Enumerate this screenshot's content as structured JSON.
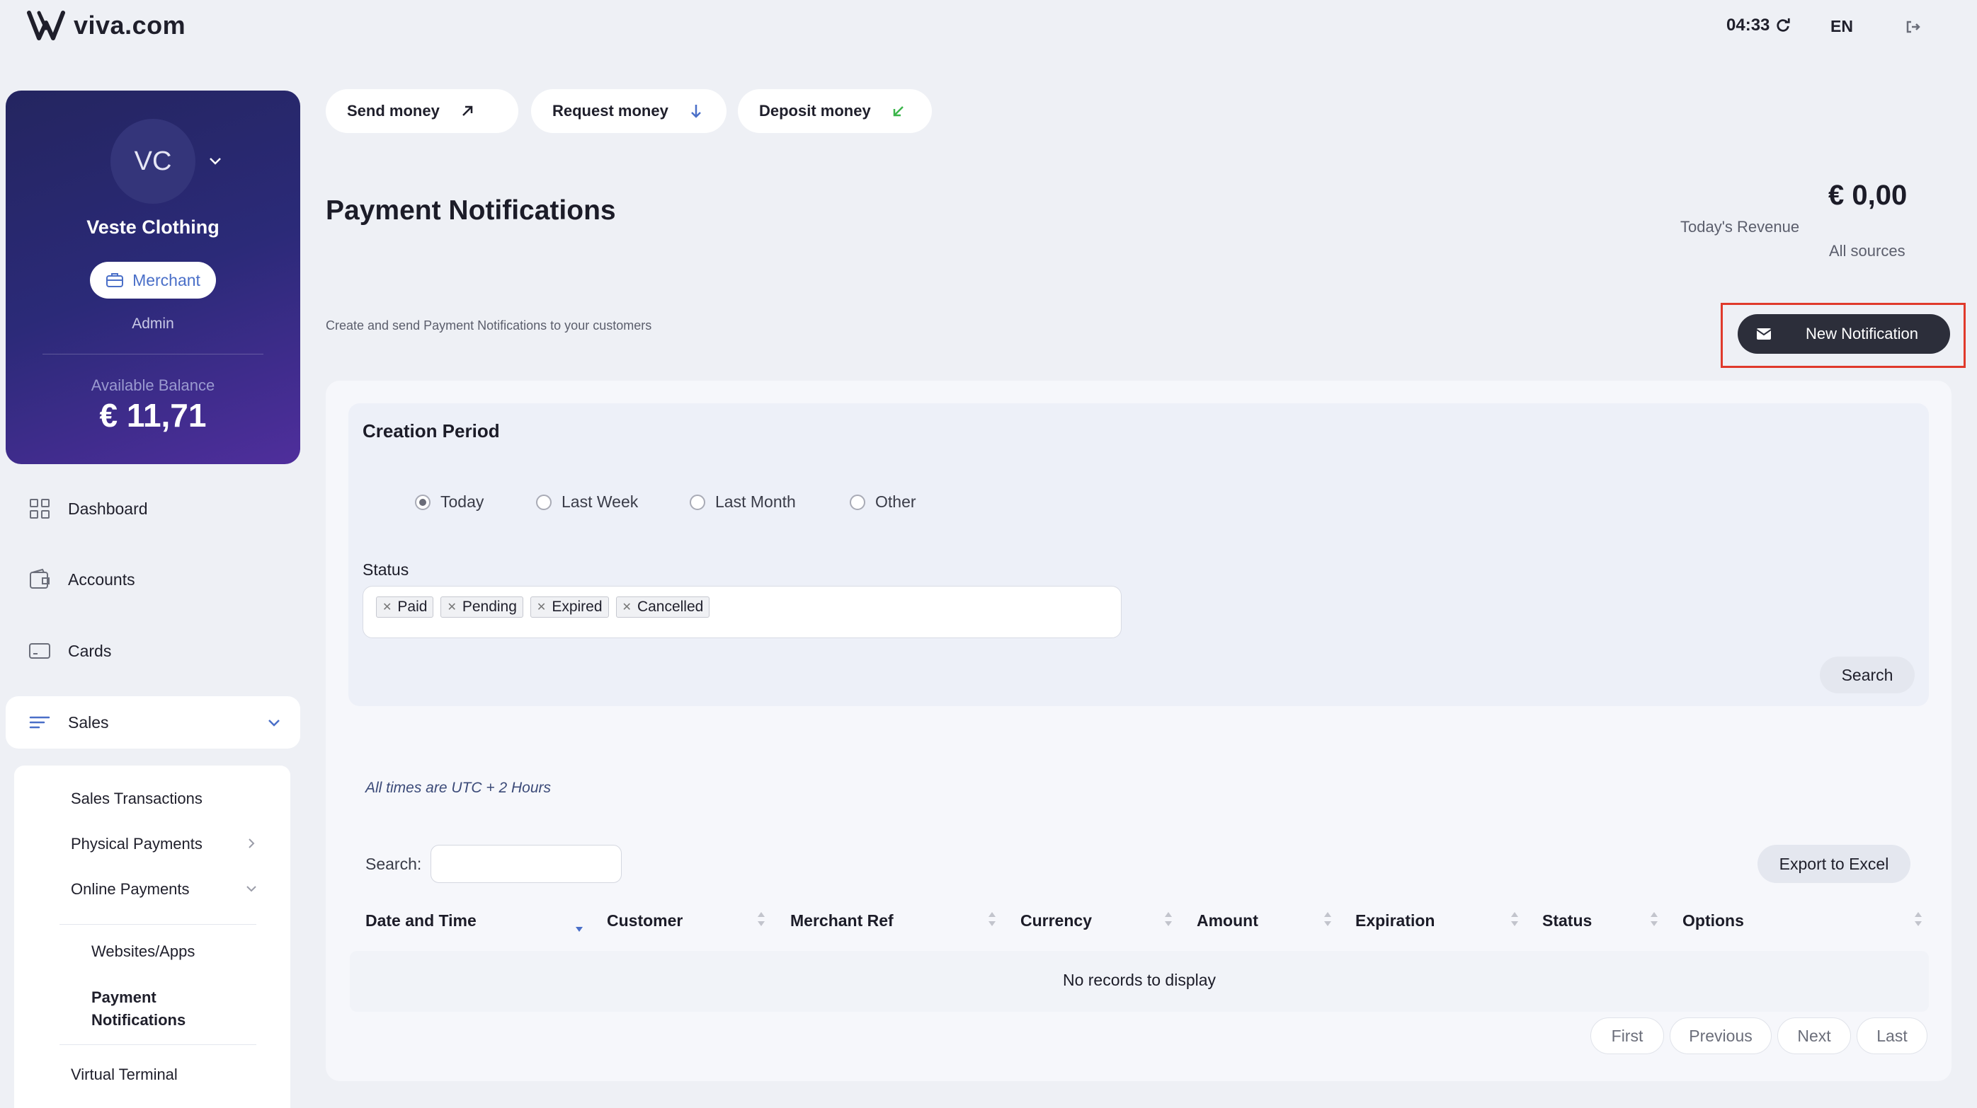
{
  "app": {
    "brand": "viva.com",
    "time": "04:33",
    "language": "EN"
  },
  "profile": {
    "initials": "VC",
    "company": "Veste Clothing",
    "badge": "Merchant",
    "role": "Admin",
    "balance_label": "Available Balance",
    "balance_value": "€ 11,71"
  },
  "nav": {
    "items": [
      {
        "label": "Dashboard",
        "icon": "grid-icon"
      },
      {
        "label": "Accounts",
        "icon": "wallet-icon"
      },
      {
        "label": "Cards",
        "icon": "card-icon"
      },
      {
        "label": "Sales",
        "icon": "list-lines-icon"
      }
    ],
    "sales_sub": {
      "sales_transactions": "Sales Transactions",
      "physical_payments": "Physical Payments",
      "online_payments": "Online Payments",
      "websites_apps": "Websites/Apps",
      "payment_notifications_1": "Payment",
      "payment_notifications_2": "Notifications",
      "virtual_terminal": "Virtual Terminal"
    }
  },
  "actions": {
    "send": "Send money",
    "request": "Request money",
    "deposit": "Deposit money"
  },
  "page": {
    "title": "Payment Notifications",
    "subtitle": "Create and send Payment Notifications to your customers",
    "revenue_value": "€ 0,00",
    "revenue_label": "Today's Revenue",
    "revenue_sources": "All sources",
    "new_button": "New Notification"
  },
  "filters": {
    "title": "Creation Period",
    "periods": [
      "Today",
      "Last Week",
      "Last Month",
      "Other"
    ],
    "selected_period": "Today",
    "status_label": "Status",
    "status_tags": [
      "Paid",
      "Pending",
      "Expired",
      "Cancelled"
    ],
    "search_button": "Search"
  },
  "table": {
    "tz_note": "All times are UTC + 2 Hours",
    "search_label": "Search:",
    "search_value": "",
    "export_button": "Export to Excel",
    "columns": [
      "Date and Time",
      "Customer",
      "Merchant Ref",
      "Currency",
      "Amount",
      "Expiration",
      "Status",
      "Options"
    ],
    "empty_text": "No records to display",
    "pager": [
      "First",
      "Previous",
      "Next",
      "Last"
    ]
  },
  "colors": {
    "accent": "#4a6fc8",
    "card_start": "#242560",
    "card_end": "#4f2e9c",
    "highlight": "#e03a2c"
  }
}
